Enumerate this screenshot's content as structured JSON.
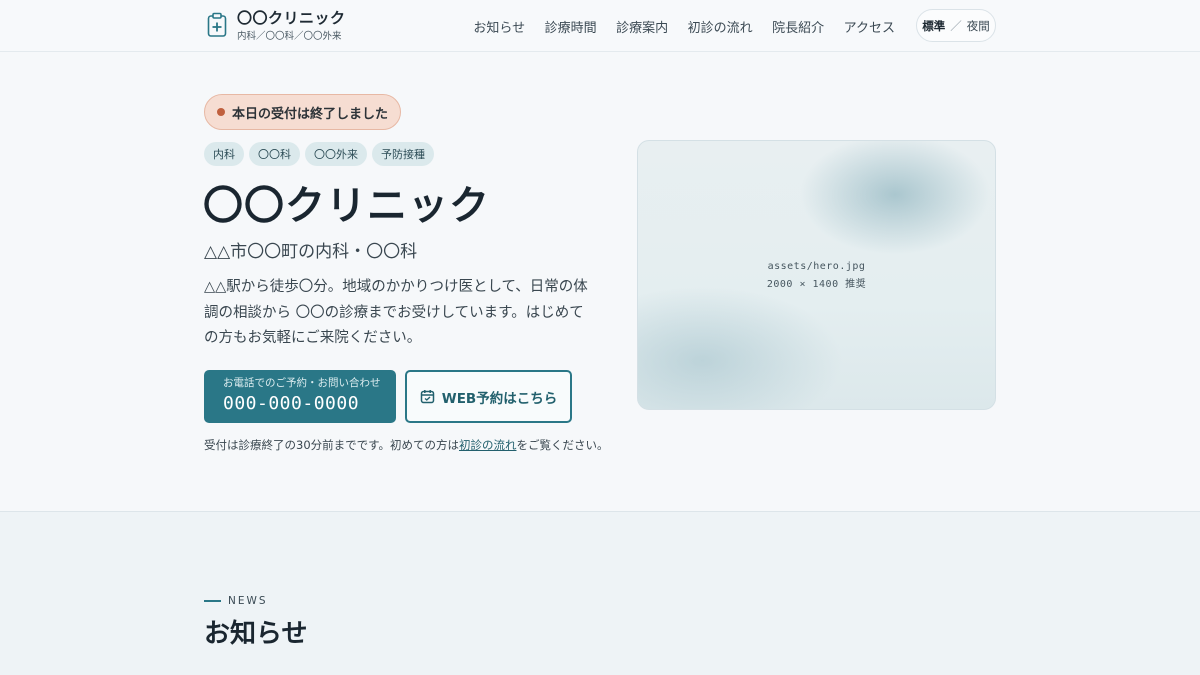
{
  "header": {
    "logo_name": "〇〇クリニック",
    "logo_sub": "内科／〇〇科／〇〇外来",
    "nav": [
      {
        "label": "お知らせ"
      },
      {
        "label": "診療時間"
      },
      {
        "label": "診療案内"
      },
      {
        "label": "初診の流れ"
      },
      {
        "label": "院長紹介"
      },
      {
        "label": "アクセス"
      }
    ],
    "mode_toggle": {
      "standard": "標準",
      "separator": "／",
      "night": "夜間"
    }
  },
  "hero": {
    "status_badge": "本日の受付は終了しました",
    "tags": [
      "内科",
      "〇〇科",
      "〇〇外来",
      "予防接種"
    ],
    "title": "〇〇クリニック",
    "subtitle": "△△市〇〇町の内科・〇〇科",
    "description": "△△駅から徒歩〇分。地域のかかりつけ医として、日常の体調の相談から 〇〇の診療までお受けしています。はじめての方もお気軽にご来院ください。",
    "phone_label": "お電話でのご予約・お問い合わせ",
    "phone_number": "000-000-0000",
    "web_button": "WEB予約はこちら",
    "note_before": "受付は診療終了の30分前までです。初めての方は",
    "note_link": "初診の流れ",
    "note_after": "をご覧ください。",
    "image_caption_line1": "assets/hero.jpg",
    "image_caption_line2": "2000 × 1400 推奨"
  },
  "news": {
    "eyebrow": "NEWS",
    "title": "お知らせ"
  },
  "colors": {
    "accent": "#2a7787",
    "badge_bg": "#f6ddd2",
    "badge_dot": "#c0603e",
    "tag_bg": "#dbe9ec"
  }
}
